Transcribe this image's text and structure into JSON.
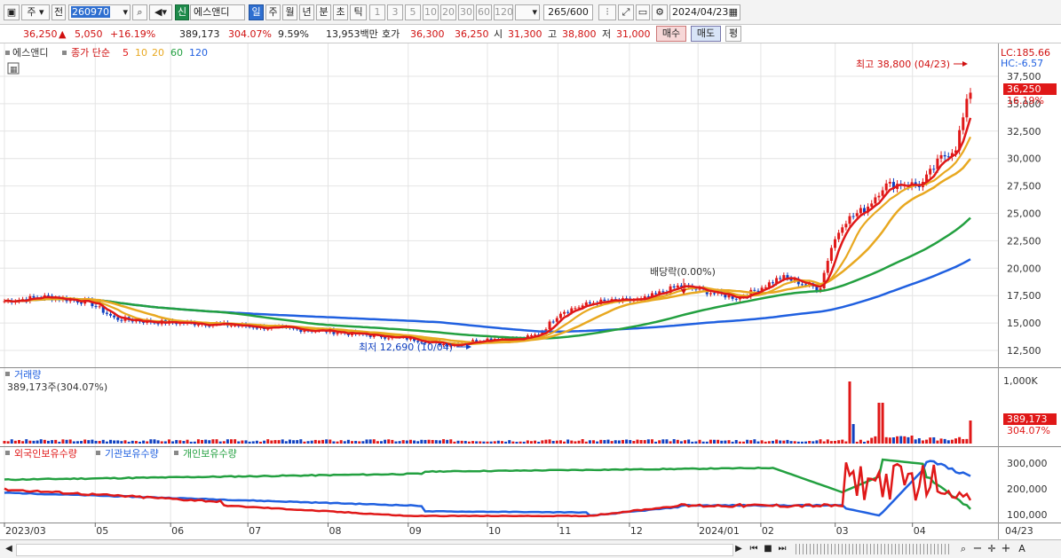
{
  "toolbar": {
    "period_type": "주",
    "prev_label": "전",
    "code": "260970",
    "stock_badge": "신",
    "stock_name": "에스앤디",
    "periods": [
      "일",
      "주",
      "월",
      "년",
      "분",
      "초",
      "틱"
    ],
    "active_period": "일",
    "intervals": [
      "1",
      "3",
      "5",
      "10",
      "20",
      "30",
      "60",
      "120"
    ],
    "count": "265",
    "count_total": "/600",
    "date": "2024/04/23"
  },
  "quote": {
    "price": "36,250",
    "change": "5,050",
    "change_pct": "+16.19%",
    "volume": "389,173",
    "volume_ratio": "304.07%",
    "turnover": "9.59%",
    "amount": "13,953백만",
    "hoga_label": "호가",
    "ask": "36,300",
    "bid": "36,250",
    "open_label": "시",
    "open": "31,300",
    "high_label": "고",
    "high": "38,800",
    "low_label": "저",
    "low": "31,000",
    "buy_button": "매수",
    "sell_button": "매도",
    "eval_button": "평"
  },
  "price_panel": {
    "stock_legend": "에스앤디",
    "ma_legend_title": "종가 단순",
    "ma_periods": [
      "5",
      "10",
      "20",
      "60",
      "120"
    ],
    "ma_colors": [
      "#e01818",
      "#e8a820",
      "#e8a820",
      "#23a040",
      "#2060e0"
    ],
    "lc_label": "LC:185.66",
    "hc_label": "HC:-6.57",
    "price_tag": "36,250",
    "pct_tag": "16.19%",
    "y_ticks": [
      "37,500",
      "35,000",
      "32,500",
      "30,000",
      "27,500",
      "25,000",
      "22,500",
      "20,000",
      "17,500",
      "15,000",
      "12,500"
    ],
    "high_annotation": "최고 38,800 (04/23)",
    "low_annotation": "최저 12,690 (10/04)",
    "dividend_annotation": "배당락(0.00%)"
  },
  "volume_panel": {
    "title": "거래량",
    "value_label": "389,173주(304.07%)",
    "y_tick": "1,000K",
    "volume_tag": "389,173",
    "ratio_tag": "304.07%"
  },
  "holding_panel": {
    "legend_foreign": "외국인보유수량",
    "legend_inst": "기관보유수량",
    "legend_indiv": "개인보유수량",
    "y_ticks": [
      "300,000",
      "200,000",
      "100,000"
    ]
  },
  "x_axis": {
    "labels": [
      "2023/03",
      "05",
      "06",
      "07",
      "08",
      "09",
      "10",
      "11",
      "12",
      "2024/01",
      "02",
      "03",
      "04"
    ],
    "right_label": "04/23"
  },
  "colors": {
    "up": "#e01818",
    "down": "#1040c0",
    "ma5": "#e01818",
    "ma10": "#e8a820",
    "ma60": "#23a040",
    "ma120": "#2060e0"
  }
}
